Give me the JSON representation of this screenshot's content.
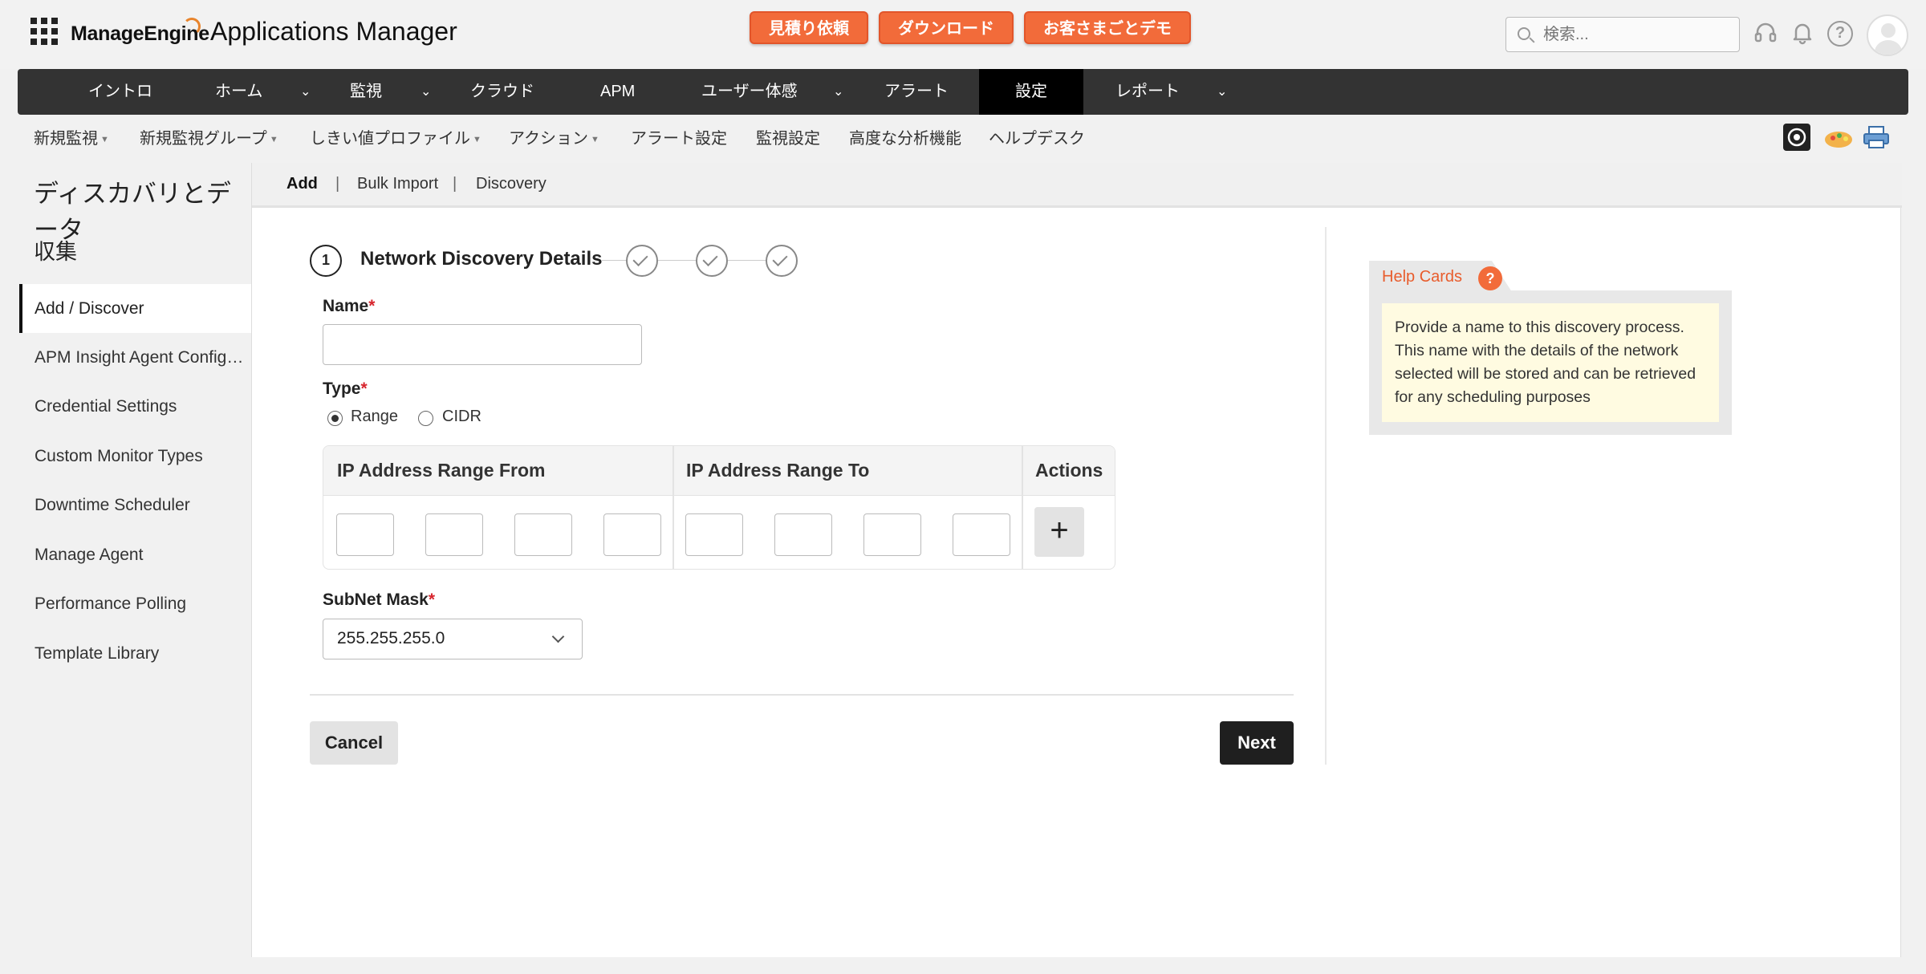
{
  "header": {
    "brand": "ManageEngine",
    "app_title": "Applications Manager",
    "promo_buttons": [
      "見積り依頼",
      "ダウンロード",
      "お客さまごとデモ"
    ],
    "search_placeholder": "検索...",
    "icons": [
      "headset-icon",
      "bell-icon",
      "help-icon",
      "avatar"
    ]
  },
  "main_nav": [
    "イントロ",
    "ホーム",
    "監視",
    "クラウド",
    "APM",
    "ユーザー体感",
    "アラート",
    "設定",
    "レポート"
  ],
  "main_nav_active": "設定",
  "sub_nav": [
    "新規監視",
    "新規監視グループ",
    "しきい値プロファイル",
    "アクション",
    "アラート設定",
    "監視設定",
    "高度な分析機能",
    "ヘルプデスク"
  ],
  "sidebar": {
    "title": "ディスカバリとデータ",
    "subtitle": "収集",
    "items": [
      "Add / Discover",
      "APM Insight Agent Configuration",
      "Credential Settings",
      "Custom Monitor Types",
      "Downtime Scheduler",
      "Manage Agent",
      "Performance Polling",
      "Template Library"
    ],
    "active": "Add / Discover"
  },
  "tabs": [
    "Add",
    "Bulk Import",
    "Discovery"
  ],
  "tab_separator": "|",
  "wizard": {
    "step_number": "1",
    "step_title": "Network Discovery Details"
  },
  "form": {
    "name_label": "Name",
    "name_value": "",
    "type_label": "Type",
    "type_options": [
      "Range",
      "CIDR"
    ],
    "type_selected": "Range",
    "required_mark": "*",
    "ip_table": {
      "col_from": "IP Address Range From",
      "col_to": "IP Address Range To",
      "col_actions": "Actions",
      "add_symbol": "+"
    },
    "subnet_label": "SubNet Mask",
    "subnet_value": "255.255.255.0"
  },
  "buttons": {
    "cancel": "Cancel",
    "next": "Next"
  },
  "help_card": {
    "title": "Help Cards",
    "icon": "?",
    "text": "Provide a name to this discovery process. This name with the details of the network selected will be stored and can be retrieved for any scheduling purposes"
  }
}
